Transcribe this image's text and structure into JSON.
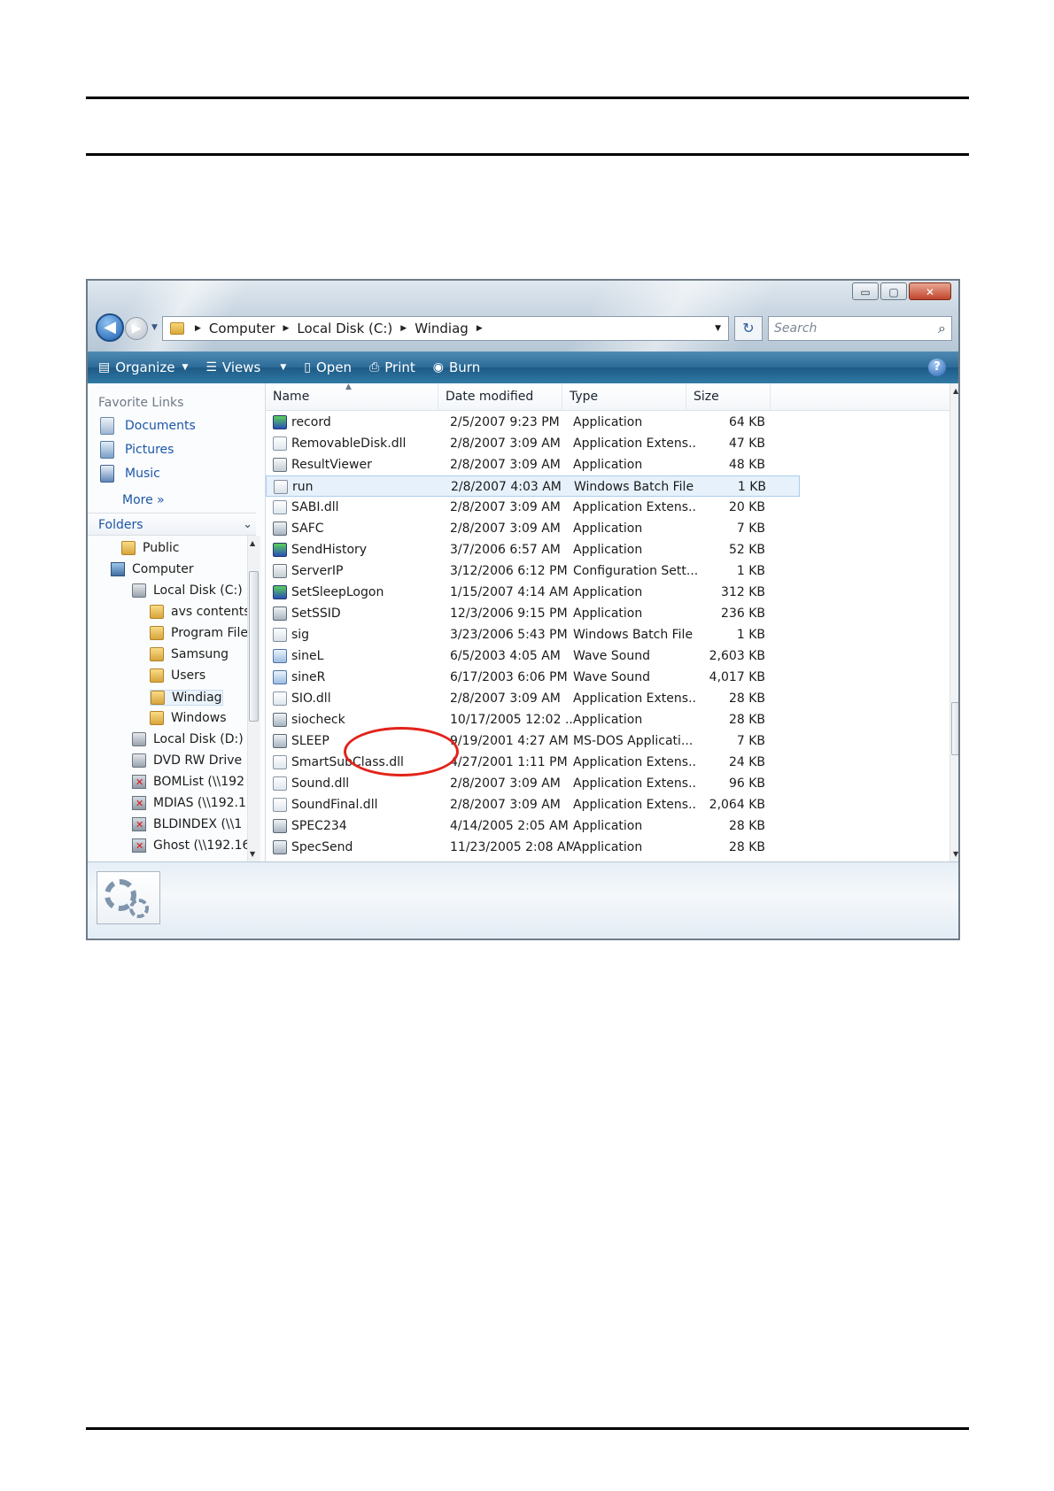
{
  "window": {
    "controls": {
      "minimize": "▭",
      "maximize": "▢",
      "close": "✕"
    }
  },
  "address": {
    "crumbs": [
      "Computer",
      "Local Disk (C:)",
      "Windiag"
    ],
    "search_placeholder": "Search"
  },
  "toolbar": {
    "organize": "Organize",
    "views": "Views",
    "open": "Open",
    "print": "Print",
    "burn": "Burn",
    "help": "?"
  },
  "nav": {
    "favorites_header": "Favorite Links",
    "favorites": [
      "Documents",
      "Pictures",
      "Music"
    ],
    "more": "More",
    "folders_header": "Folders",
    "tree": [
      {
        "label": "Public",
        "icon": "folder-icon"
      },
      {
        "label": "Computer",
        "icon": "computer-icon"
      },
      {
        "label": "Local Disk (C:)",
        "icon": "disk-icon"
      },
      {
        "label": "avs contents",
        "icon": "folder-icon"
      },
      {
        "label": "Program Files",
        "icon": "folder-icon"
      },
      {
        "label": "Samsung",
        "icon": "folder-icon"
      },
      {
        "label": "Users",
        "icon": "folder-icon"
      },
      {
        "label": "Windiag",
        "icon": "folder-icon",
        "selected": true
      },
      {
        "label": "Windows",
        "icon": "folder-icon"
      },
      {
        "label": "Local Disk (D:)",
        "icon": "disk-icon"
      },
      {
        "label": "DVD RW Drive",
        "icon": "dvd-icon"
      },
      {
        "label": "BOMList (\\\\192",
        "icon": "network-drive-icon"
      },
      {
        "label": "MDIAS (\\\\192.1",
        "icon": "network-drive-icon"
      },
      {
        "label": "BLDINDEX (\\\\1",
        "icon": "network-drive-icon"
      },
      {
        "label": "Ghost (\\\\192.16",
        "icon": "network-drive-icon"
      }
    ]
  },
  "columns": {
    "name": "Name",
    "date": "Date modified",
    "type": "Type",
    "size": "Size"
  },
  "files": [
    {
      "name": "record",
      "date": "2/5/2007 9:23 PM",
      "type": "Application",
      "size": "64 KB",
      "icon": "color-app"
    },
    {
      "name": "RemovableDisk.dll",
      "date": "2/8/2007 3:09 AM",
      "type": "Application Extens...",
      "size": "47 KB",
      "icon": "dll"
    },
    {
      "name": "ResultViewer",
      "date": "2/8/2007 3:09 AM",
      "type": "Application",
      "size": "48 KB",
      "icon": "cfg"
    },
    {
      "name": "run",
      "date": "2/8/2007 4:03 AM",
      "type": "Windows Batch File",
      "size": "1 KB",
      "icon": "bat",
      "selected": true
    },
    {
      "name": "SABI.dll",
      "date": "2/8/2007 3:09 AM",
      "type": "Application Extens...",
      "size": "20 KB",
      "icon": "dll"
    },
    {
      "name": "SAFC",
      "date": "2/8/2007 3:09 AM",
      "type": "Application",
      "size": "7 KB",
      "icon": "app"
    },
    {
      "name": "SendHistory",
      "date": "3/7/2006 6:57 AM",
      "type": "Application",
      "size": "52 KB",
      "icon": "color-app"
    },
    {
      "name": "ServerIP",
      "date": "3/12/2006 6:12 PM",
      "type": "Configuration Sett...",
      "size": "1 KB",
      "icon": "cfg"
    },
    {
      "name": "SetSleepLogon",
      "date": "1/15/2007 4:14 AM",
      "type": "Application",
      "size": "312 KB",
      "icon": "color-app"
    },
    {
      "name": "SetSSID",
      "date": "12/3/2006 9:15 PM",
      "type": "Application",
      "size": "236 KB",
      "icon": "app"
    },
    {
      "name": "sig",
      "date": "3/23/2006 5:43 PM",
      "type": "Windows Batch File",
      "size": "1 KB",
      "icon": "bat"
    },
    {
      "name": "sineL",
      "date": "6/5/2003 4:05 AM",
      "type": "Wave Sound",
      "size": "2,603 KB",
      "icon": "wav"
    },
    {
      "name": "sineR",
      "date": "6/17/2003 6:06 PM",
      "type": "Wave Sound",
      "size": "4,017 KB",
      "icon": "wav"
    },
    {
      "name": "SIO.dll",
      "date": "2/8/2007 3:09 AM",
      "type": "Application Extens...",
      "size": "28 KB",
      "icon": "dll"
    },
    {
      "name": "siocheck",
      "date": "10/17/2005 12:02 ...",
      "type": "Application",
      "size": "28 KB",
      "icon": "app"
    },
    {
      "name": "SLEEP",
      "date": "9/19/2001 4:27 AM",
      "type": "MS-DOS Applicati...",
      "size": "7 KB",
      "icon": "app"
    },
    {
      "name": "SmartSubClass.dll",
      "date": "4/27/2001 1:11 PM",
      "type": "Application Extens...",
      "size": "24 KB",
      "icon": "dll"
    },
    {
      "name": "Sound.dll",
      "date": "2/8/2007 3:09 AM",
      "type": "Application Extens...",
      "size": "96 KB",
      "icon": "dll"
    },
    {
      "name": "SoundFinal.dll",
      "date": "2/8/2007 3:09 AM",
      "type": "Application Extens...",
      "size": "2,064 KB",
      "icon": "dll"
    },
    {
      "name": "SPEC234",
      "date": "4/14/2005 2:05 AM",
      "type": "Application",
      "size": "28 KB",
      "icon": "app"
    },
    {
      "name": "SpecSend",
      "date": "11/23/2005 2:08 AM",
      "type": "Application",
      "size": "28 KB",
      "icon": "app"
    }
  ],
  "colors": {
    "toolbar": "#2c6b98",
    "link": "#1b57a8",
    "highlight_circle": "#e2231a"
  }
}
